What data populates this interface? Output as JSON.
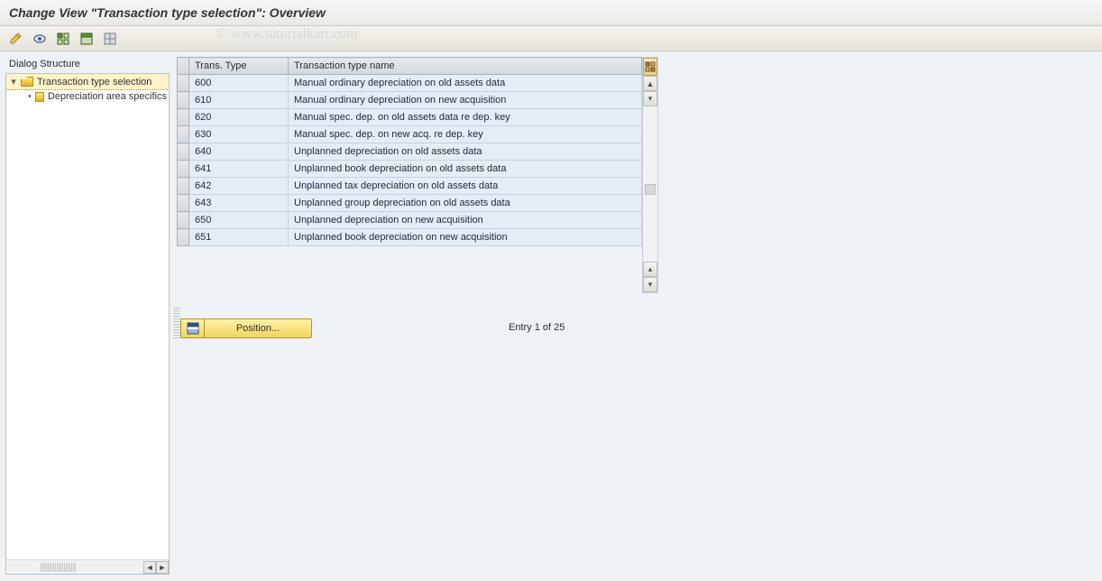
{
  "title": "Change View \"Transaction type selection\": Overview",
  "watermark": "© www.tutorialkart.com",
  "tree": {
    "heading": "Dialog Structure",
    "root": {
      "label": "Transaction type selection"
    },
    "child": {
      "label": "Depreciation area specifics"
    }
  },
  "table": {
    "col1": "Trans. Type",
    "col2": "Transaction type name",
    "rows": [
      {
        "type": "600",
        "name": "Manual ordinary depreciation on old assets data"
      },
      {
        "type": "610",
        "name": "Manual ordinary depreciation on new acquisition"
      },
      {
        "type": "620",
        "name": "Manual spec. dep. on old assets data re dep. key"
      },
      {
        "type": "630",
        "name": "Manual spec. dep. on new acq. re dep. key"
      },
      {
        "type": "640",
        "name": "Unplanned depreciation on old assets data"
      },
      {
        "type": "641",
        "name": "Unplanned book depreciation on old assets data"
      },
      {
        "type": "642",
        "name": "Unplanned tax depreciation on old assets data"
      },
      {
        "type": "643",
        "name": "Unplanned group depreciation on old assets data"
      },
      {
        "type": "650",
        "name": "Unplanned depreciation on new acquisition"
      },
      {
        "type": "651",
        "name": "Unplanned book depreciation on new acquisition"
      }
    ]
  },
  "position_button": "Position...",
  "entry_text": "Entry 1 of 25"
}
